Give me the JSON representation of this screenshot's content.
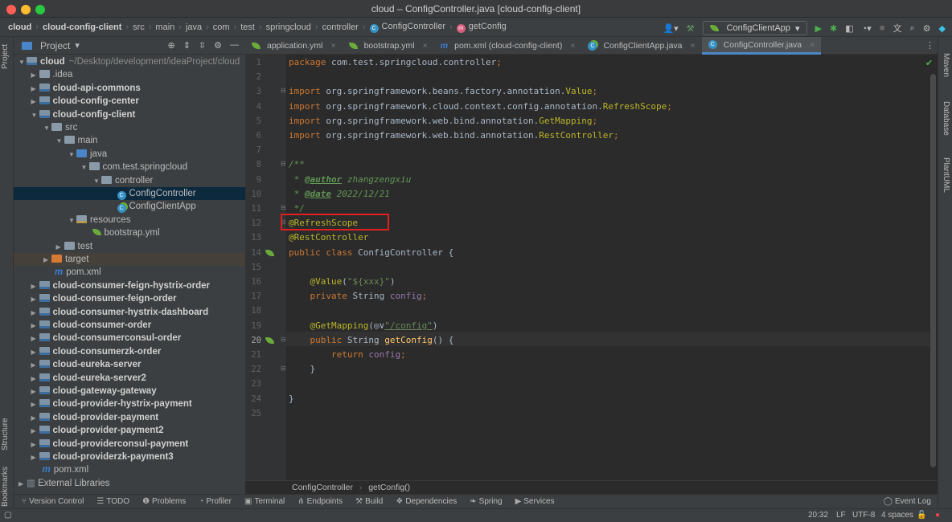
{
  "window": {
    "title": "cloud – ConfigController.java [cloud-config-client]"
  },
  "breadcrumb": [
    "cloud",
    "cloud-config-client",
    "src",
    "main",
    "java",
    "com",
    "test",
    "springcloud",
    "controller",
    "ConfigController",
    "getConfig"
  ],
  "run_config": "ConfigClientApp",
  "project_panel": {
    "title": "Project"
  },
  "tree": [
    {
      "label": "cloud",
      "extra": "~/Desktop/development/ideaProject/cloud",
      "level": 0,
      "arrow": "open",
      "icon": "module",
      "bold": true
    },
    {
      "label": ".idea",
      "level": 1,
      "arrow": "closed",
      "icon": "folder"
    },
    {
      "label": "cloud-api-commons",
      "level": 1,
      "arrow": "closed",
      "icon": "module",
      "bold": true
    },
    {
      "label": "cloud-config-center",
      "level": 1,
      "arrow": "closed",
      "icon": "module",
      "bold": true
    },
    {
      "label": "cloud-config-client",
      "level": 1,
      "arrow": "open",
      "icon": "module",
      "bold": true
    },
    {
      "label": "src",
      "level": 2,
      "arrow": "open",
      "icon": "folder"
    },
    {
      "label": "main",
      "level": 3,
      "arrow": "open",
      "icon": "folder"
    },
    {
      "label": "java",
      "level": 4,
      "arrow": "open",
      "icon": "source"
    },
    {
      "label": "com.test.springcloud",
      "level": 5,
      "arrow": "open",
      "icon": "folder"
    },
    {
      "label": "controller",
      "level": 6,
      "arrow": "open",
      "icon": "folder"
    },
    {
      "label": "ConfigController",
      "level": 7,
      "icon": "class",
      "selected": true
    },
    {
      "label": "ConfigClientApp",
      "level": 7,
      "icon": "spring-class"
    },
    {
      "label": "resources",
      "level": 4,
      "arrow": "open",
      "icon": "resources"
    },
    {
      "label": "bootstrap.yml",
      "level": 5,
      "icon": "spring-yml"
    },
    {
      "label": "test",
      "level": 3,
      "arrow": "closed",
      "icon": "folder"
    },
    {
      "label": "target",
      "level": 2,
      "arrow": "closed",
      "icon": "target",
      "highlight": true
    },
    {
      "label": "pom.xml",
      "level": 2,
      "icon": "maven"
    },
    {
      "label": "cloud-consumer-feign-hystrix-order",
      "level": 1,
      "arrow": "closed",
      "icon": "module",
      "bold": true
    },
    {
      "label": "cloud-consumer-feign-order",
      "level": 1,
      "arrow": "closed",
      "icon": "module",
      "bold": true
    },
    {
      "label": "cloud-consumer-hystrix-dashboard",
      "level": 1,
      "arrow": "closed",
      "icon": "module",
      "bold": true
    },
    {
      "label": "cloud-consumer-order",
      "level": 1,
      "arrow": "closed",
      "icon": "module",
      "bold": true
    },
    {
      "label": "cloud-consumerconsul-order",
      "level": 1,
      "arrow": "closed",
      "icon": "module",
      "bold": true
    },
    {
      "label": "cloud-consumerzk-order",
      "level": 1,
      "arrow": "closed",
      "icon": "module",
      "bold": true
    },
    {
      "label": "cloud-eureka-server",
      "level": 1,
      "arrow": "closed",
      "icon": "module",
      "bold": true
    },
    {
      "label": "cloud-eureka-server2",
      "level": 1,
      "arrow": "closed",
      "icon": "module",
      "bold": true
    },
    {
      "label": "cloud-gateway-gateway",
      "level": 1,
      "arrow": "closed",
      "icon": "module",
      "bold": true
    },
    {
      "label": "cloud-provider-hystrix-payment",
      "level": 1,
      "arrow": "closed",
      "icon": "module",
      "bold": true
    },
    {
      "label": "cloud-provider-payment",
      "level": 1,
      "arrow": "closed",
      "icon": "module",
      "bold": true
    },
    {
      "label": "cloud-provider-payment2",
      "level": 1,
      "arrow": "closed",
      "icon": "module",
      "bold": true
    },
    {
      "label": "cloud-providerconsul-payment",
      "level": 1,
      "arrow": "closed",
      "icon": "module",
      "bold": true
    },
    {
      "label": "cloud-providerzk-payment3",
      "level": 1,
      "arrow": "closed",
      "icon": "module",
      "bold": true
    },
    {
      "label": "pom.xml",
      "level": 1,
      "icon": "maven"
    },
    {
      "label": "External Libraries",
      "level": 0,
      "arrow": "closed",
      "icon": "libraries"
    }
  ],
  "tabs": [
    {
      "label": "application.yml",
      "icon": "spring-yml"
    },
    {
      "label": "bootstrap.yml",
      "icon": "spring-yml"
    },
    {
      "label": "pom.xml (cloud-config-client)",
      "icon": "maven"
    },
    {
      "label": "ConfigClientApp.java",
      "icon": "spring-class"
    },
    {
      "label": "ConfigController.java",
      "icon": "class",
      "active": true
    }
  ],
  "code": [
    [
      [
        "package ",
        "kw"
      ],
      [
        "com.test.springcloud.controller",
        "pl"
      ],
      [
        ";",
        "kw"
      ]
    ],
    [],
    [
      [
        "import ",
        "kw"
      ],
      [
        "org.springframework.beans.factory.annotation.",
        "pl"
      ],
      [
        "Value",
        "an"
      ],
      [
        ";",
        "kw"
      ]
    ],
    [
      [
        "import ",
        "kw"
      ],
      [
        "org.springframework.cloud.context.config.annotation.",
        "pl"
      ],
      [
        "RefreshScope",
        "an"
      ],
      [
        ";",
        "kw"
      ]
    ],
    [
      [
        "import ",
        "kw"
      ],
      [
        "org.springframework.web.bind.annotation.",
        "pl"
      ],
      [
        "GetMapping",
        "an"
      ],
      [
        ";",
        "kw"
      ]
    ],
    [
      [
        "import ",
        "kw"
      ],
      [
        "org.springframework.web.bind.annotation.",
        "pl"
      ],
      [
        "RestController",
        "an"
      ],
      [
        ";",
        "kw"
      ]
    ],
    [],
    [
      [
        "/**",
        "cm"
      ]
    ],
    [
      [
        " * ",
        "cm"
      ],
      [
        "@author",
        "tag"
      ],
      [
        " zhangzengxiu",
        "cm"
      ]
    ],
    [
      [
        " * ",
        "cm"
      ],
      [
        "@date",
        "tag"
      ],
      [
        " 2022/12/21",
        "cm"
      ]
    ],
    [
      [
        " */",
        "cm"
      ]
    ],
    [
      [
        "@RefreshScope",
        "an"
      ]
    ],
    [
      [
        "@RestController",
        "an"
      ]
    ],
    [
      [
        "public class ",
        "kw"
      ],
      [
        "ConfigController {",
        "pl"
      ]
    ],
    [],
    [
      [
        "    @Value",
        "an"
      ],
      [
        "(",
        "pl"
      ],
      [
        "\"${xxx}\"",
        "st"
      ],
      [
        ")",
        "pl"
      ]
    ],
    [
      [
        "    private ",
        "kw"
      ],
      [
        "String ",
        "pl"
      ],
      [
        "config",
        "fd"
      ],
      [
        ";",
        "kw"
      ]
    ],
    [],
    [
      [
        "    @GetMapping",
        "an"
      ],
      [
        "(",
        "pl"
      ],
      [
        "◎∨",
        "pl"
      ],
      [
        "\"/config\"",
        "url"
      ],
      [
        ")",
        "pl"
      ]
    ],
    [
      [
        "    public ",
        "kw"
      ],
      [
        "String ",
        "pl"
      ],
      [
        "getConfig",
        "fn"
      ],
      [
        "() {",
        "pl"
      ]
    ],
    [
      [
        "        return ",
        "kw"
      ],
      [
        "config",
        "fd"
      ],
      [
        ";",
        "kw"
      ]
    ],
    [
      [
        "    }",
        "pl"
      ]
    ],
    [],
    [
      [
        "}",
        "pl"
      ]
    ],
    []
  ],
  "current_line": 20,
  "editor_breadcrumb": [
    "ConfigController",
    "getConfig()"
  ],
  "bottom_tools": [
    "Version Control",
    "TODO",
    "Problems",
    "Profiler",
    "Terminal",
    "Endpoints",
    "Build",
    "Dependencies",
    "Spring",
    "Services"
  ],
  "event_log": "Event Log",
  "left_strip": [
    "Project",
    "Structure",
    "Bookmarks"
  ],
  "right_strip": [
    "Maven",
    "Database",
    "PlantUML"
  ],
  "status": {
    "position": "20:32",
    "line_sep": "LF",
    "encoding": "UTF-8",
    "indent": "4 spaces"
  },
  "colors": {
    "accent": "#4a88c7",
    "highlight_box": "#e02020",
    "keyword": "#cc7832",
    "annotation": "#bbb529"
  }
}
